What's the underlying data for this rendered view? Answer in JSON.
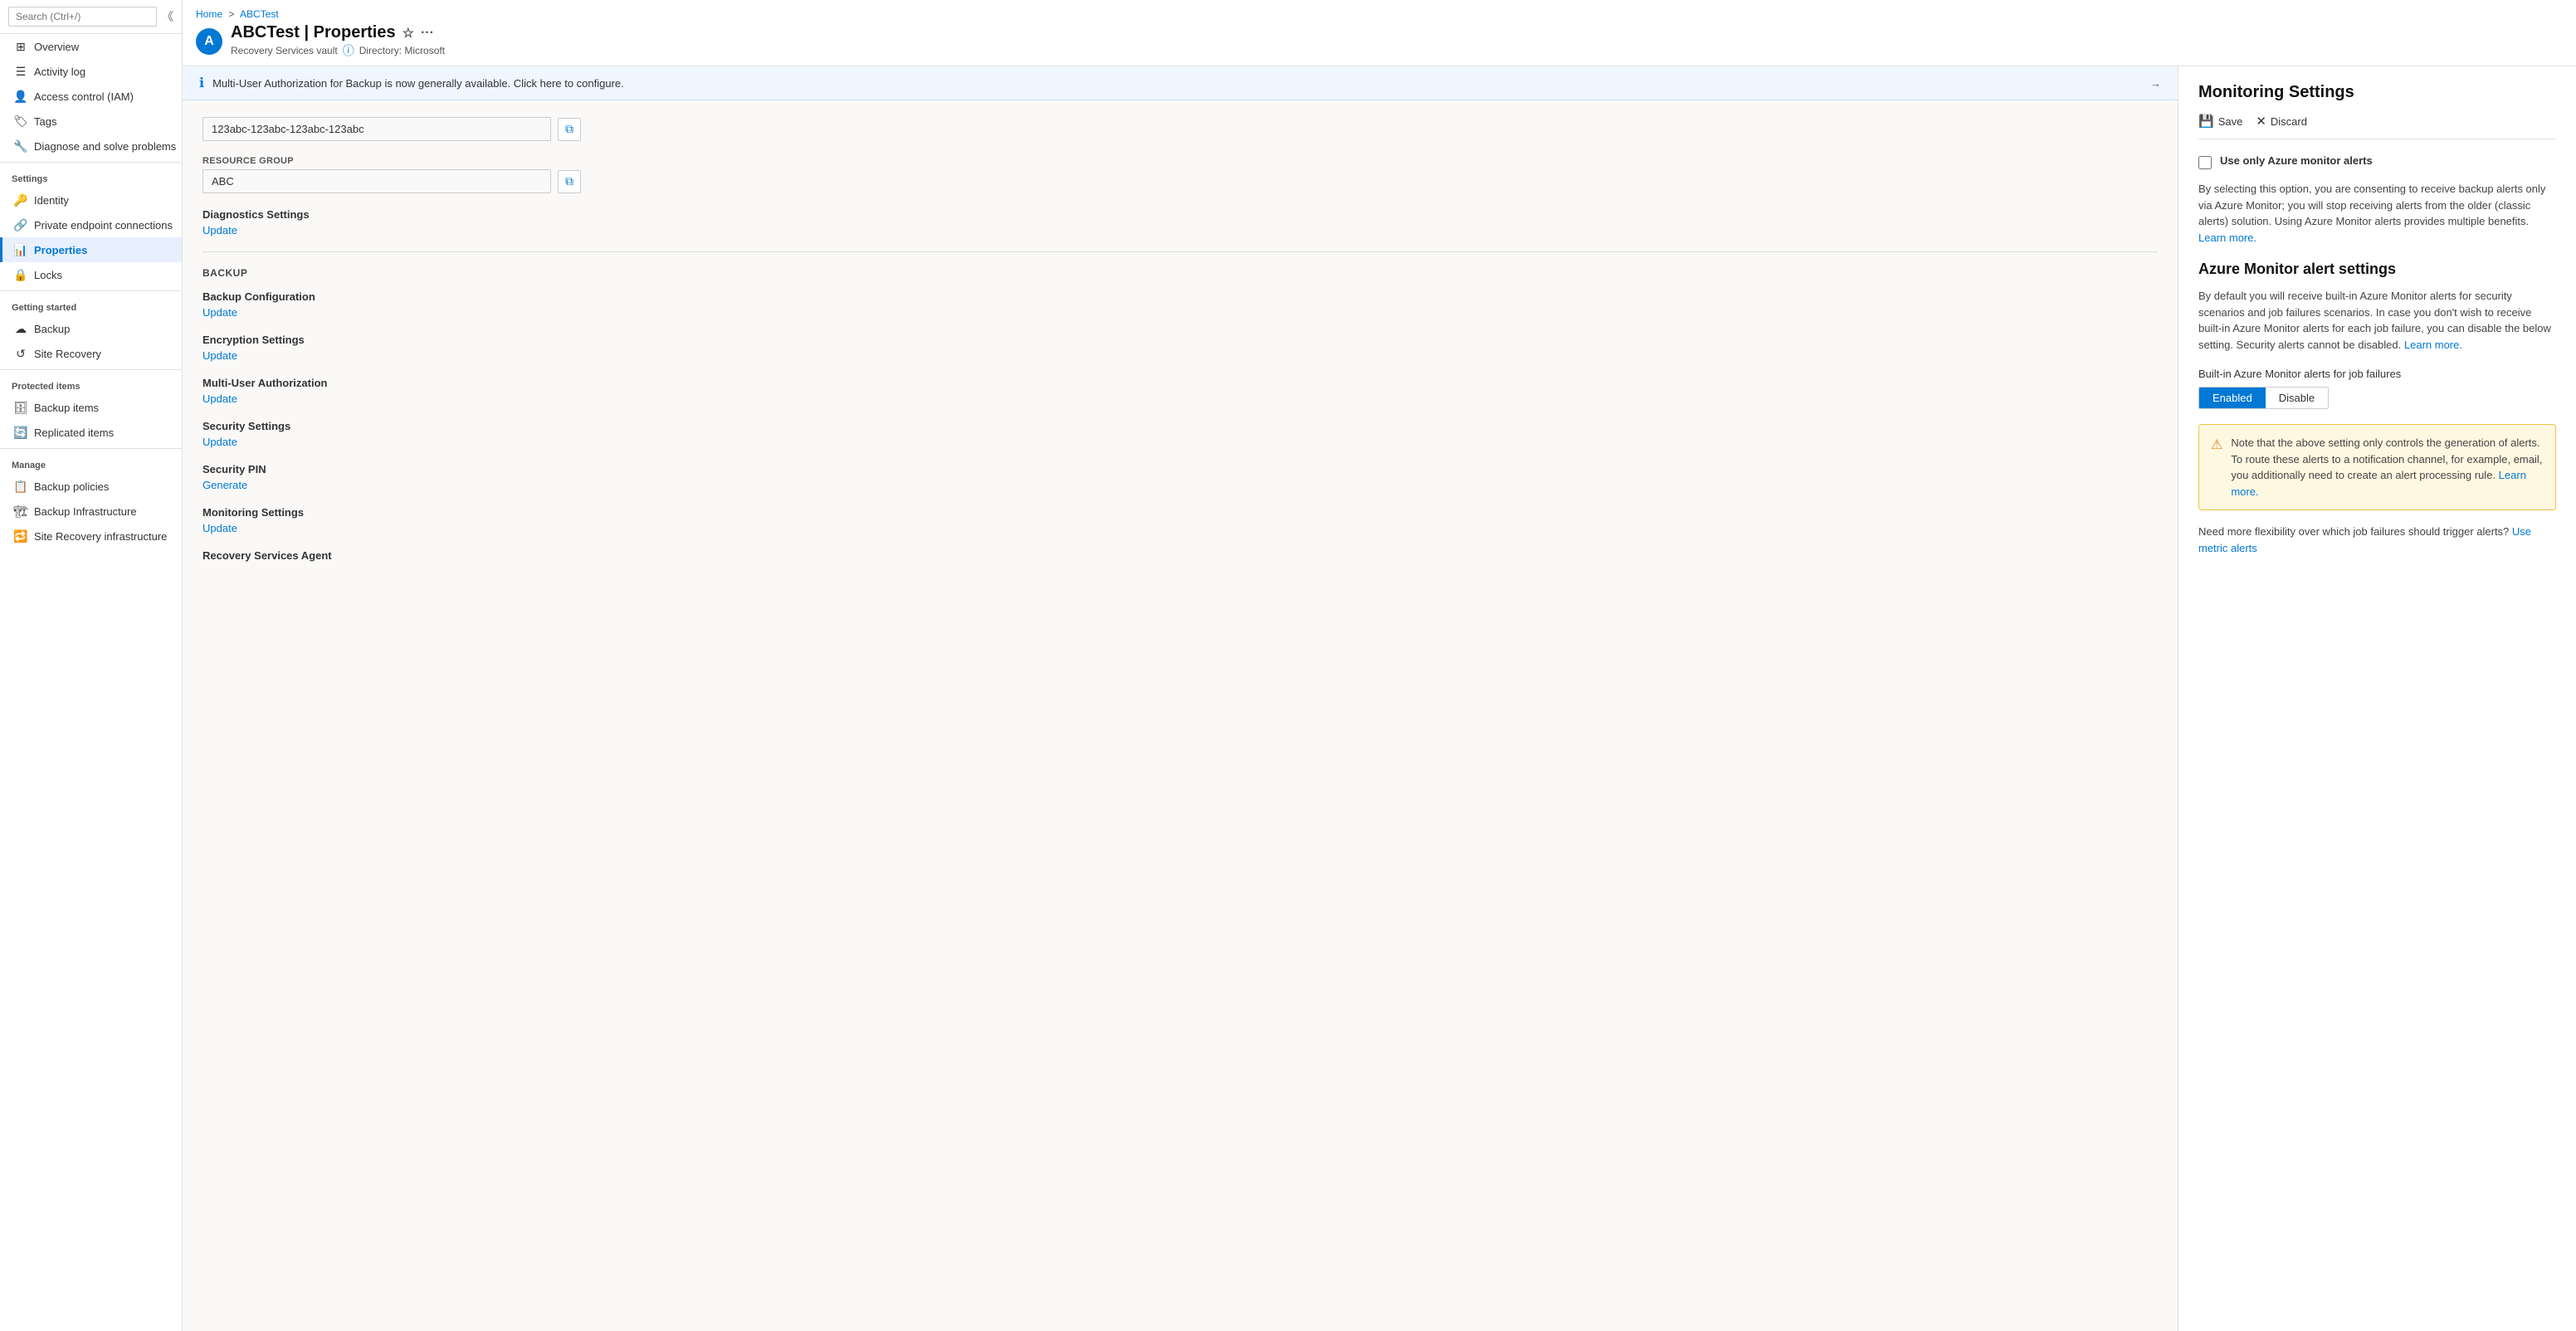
{
  "breadcrumb": {
    "home": "Home",
    "separator": ">",
    "current": "ABCTest"
  },
  "page": {
    "title": "ABCTest | Properties",
    "name": "ABCTest",
    "section": "Properties",
    "subtitle": "Recovery Services vault",
    "directory": "Directory: Microsoft",
    "icon_letter": "A"
  },
  "sidebar": {
    "search_placeholder": "Search (Ctrl+/)",
    "items": [
      {
        "id": "overview",
        "label": "Overview",
        "icon": "⊞"
      },
      {
        "id": "activity-log",
        "label": "Activity log",
        "icon": "≡"
      },
      {
        "id": "access-control",
        "label": "Access control (IAM)",
        "icon": "👤"
      },
      {
        "id": "tags",
        "label": "Tags",
        "icon": "🏷"
      },
      {
        "id": "diagnose",
        "label": "Diagnose and solve problems",
        "icon": "🔧"
      }
    ],
    "settings_section": "Settings",
    "settings_items": [
      {
        "id": "identity",
        "label": "Identity",
        "icon": "🔑"
      },
      {
        "id": "private-endpoints",
        "label": "Private endpoint connections",
        "icon": "🔗"
      },
      {
        "id": "properties",
        "label": "Properties",
        "icon": "📊",
        "active": true
      },
      {
        "id": "locks",
        "label": "Locks",
        "icon": "🔒"
      }
    ],
    "getting_started_section": "Getting started",
    "getting_started_items": [
      {
        "id": "backup",
        "label": "Backup",
        "icon": "☁"
      },
      {
        "id": "site-recovery",
        "label": "Site Recovery",
        "icon": "↺"
      }
    ],
    "protected_items_section": "Protected items",
    "protected_items": [
      {
        "id": "backup-items",
        "label": "Backup items",
        "icon": "🗄"
      },
      {
        "id": "replicated-items",
        "label": "Replicated items",
        "icon": "🔄"
      }
    ],
    "manage_section": "Manage",
    "manage_items": [
      {
        "id": "backup-policies",
        "label": "Backup policies",
        "icon": "📋"
      },
      {
        "id": "backup-infrastructure",
        "label": "Backup Infrastructure",
        "icon": "🏗"
      },
      {
        "id": "site-recovery-infrastructure",
        "label": "Site Recovery infrastructure",
        "icon": "🔁"
      }
    ]
  },
  "banner": {
    "text": "Multi-User Authorization for Backup is now generally available. Click here to configure.",
    "arrow": "→"
  },
  "properties": {
    "resource_id_label": "",
    "resource_id_value": "123abc-123abc-123abc-123abc",
    "resource_group_label": "Resource group",
    "resource_group_value": "ABC",
    "diagnostics_label": "Diagnostics Settings",
    "diagnostics_update": "Update",
    "backup_section": "BACKUP",
    "backup_config_label": "Backup Configuration",
    "backup_config_update": "Update",
    "encryption_label": "Encryption Settings",
    "encryption_update": "Update",
    "mua_label": "Multi-User Authorization",
    "mua_update": "Update",
    "security_settings_label": "Security Settings",
    "security_settings_update": "Update",
    "security_pin_label": "Security PIN",
    "security_pin_generate": "Generate",
    "monitoring_settings_label": "Monitoring Settings",
    "monitoring_settings_update": "Update",
    "recovery_agent_label": "Recovery Services Agent"
  },
  "monitoring": {
    "title": "Monitoring Settings",
    "save_label": "Save",
    "discard_label": "Discard",
    "checkbox_label": "Use only Azure monitor alerts",
    "description": "By selecting this option, you are consenting to receive backup alerts only via Azure Monitor; you will stop receiving alerts from the older (classic alerts) solution. Using Azure Monitor alerts provides multiple benefits.",
    "learn_more_1": "Learn more.",
    "azure_monitor_section": "Azure Monitor alert settings",
    "azure_monitor_description": "By default you will receive built-in Azure Monitor alerts for security scenarios and job failures scenarios. In case you don't wish to receive built-in Azure Monitor alerts for each job failure, you can disable the below setting. Security alerts cannot be disabled.",
    "learn_more_2": "Learn more.",
    "built_in_label": "Built-in Azure Monitor alerts for job failures",
    "enabled_label": "Enabled",
    "disable_label": "Disable",
    "warning_text": "Note that the above setting only controls the generation of alerts. To route these alerts to a notification channel, for example, email, you additionally need to create an alert processing rule.",
    "warning_learn_more": "Learn more.",
    "flexibility_text": "Need more flexibility over which job failures should trigger alerts?",
    "metric_alerts_link": "Use metric alerts"
  }
}
